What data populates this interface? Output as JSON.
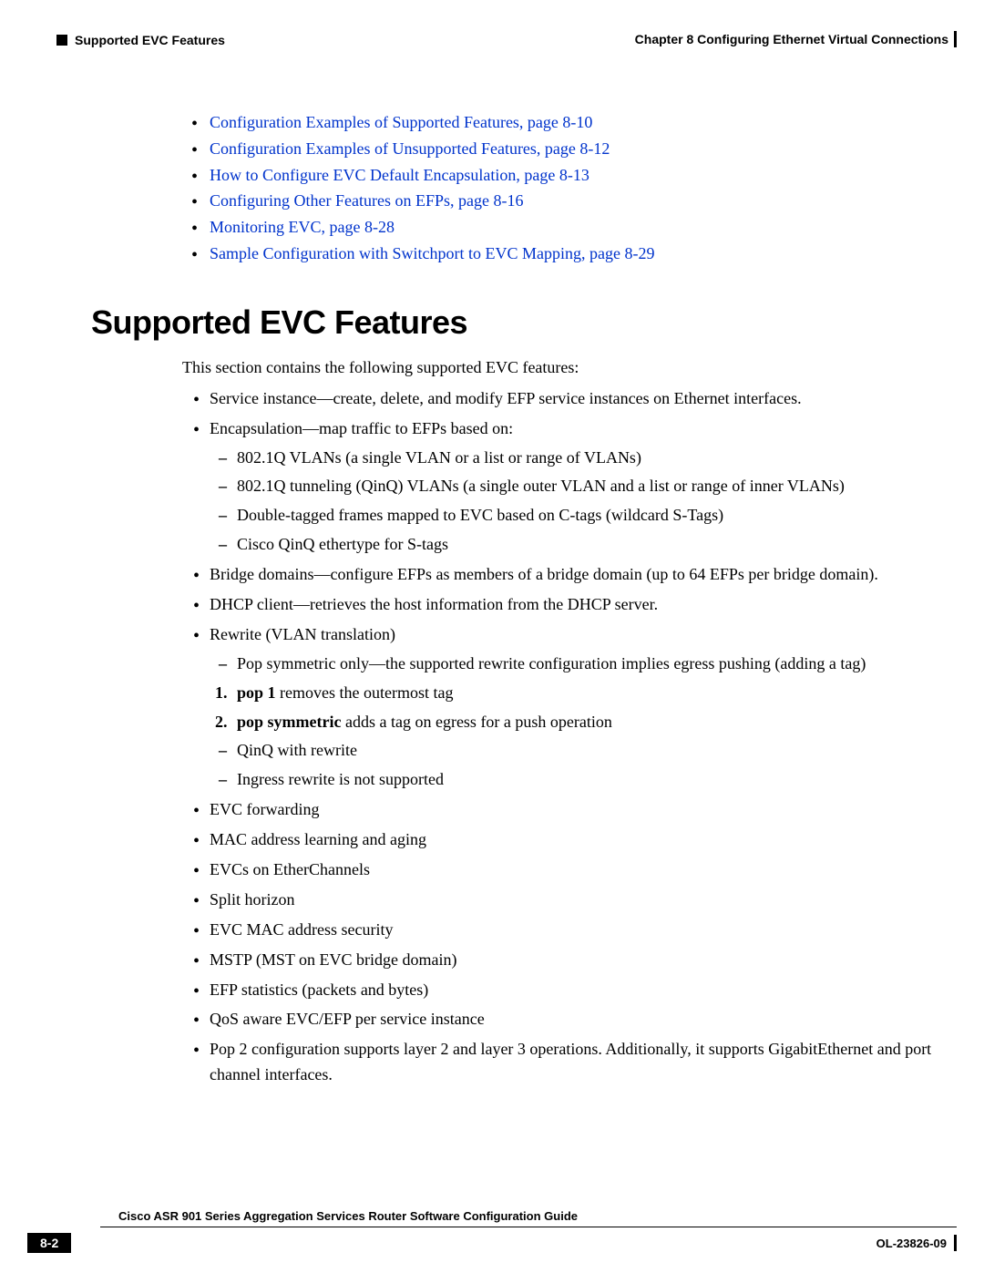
{
  "header": {
    "section": "Supported EVC Features",
    "chapter": "Chapter 8      Configuring Ethernet Virtual Connections"
  },
  "toc": [
    "Configuration Examples of Supported Features, page 8-10",
    "Configuration Examples of Unsupported Features, page 8-12",
    "How to Configure EVC Default Encapsulation, page 8-13",
    "Configuring Other Features on EFPs, page 8-16",
    "Monitoring EVC, page 8-28",
    "Sample Configuration with Switchport to EVC Mapping, page 8-29"
  ],
  "title": "Supported EVC Features",
  "intro": "This section contains the following supported EVC features:",
  "f": {
    "service_instance": "Service instance—create, delete, and modify EFP service instances on Ethernet interfaces.",
    "encapsulation": "Encapsulation—map traffic to EFPs based on:",
    "enc_sub1": "802.1Q VLANs (a single VLAN or a list or range of VLANs)",
    "enc_sub2": "802.1Q tunneling (QinQ) VLANs (a single outer VLAN and a list or range of inner VLANs)",
    "enc_sub3": "Double-tagged frames mapped to EVC based on C-tags (wildcard S-Tags)",
    "enc_sub4": "Cisco QinQ ethertype for S-tags",
    "bridge": "Bridge domains—configure EFPs as members of a bridge domain (up to 64 EFPs per bridge domain).",
    "dhcp": "DHCP client—retrieves the host information from the DHCP server.",
    "rewrite": "Rewrite (VLAN translation)",
    "rw_sub1": "Pop symmetric only—the supported rewrite configuration implies egress pushing (adding a tag)",
    "rw_num1_b": "pop 1",
    "rw_num1_r": " removes the outermost tag",
    "rw_num2_b": "pop symmetric",
    "rw_num2_r": " adds a tag on egress for a push operation",
    "rw_sub2": "QinQ with rewrite",
    "rw_sub3": "Ingress rewrite is not supported",
    "evc_fwd": "EVC forwarding",
    "mac": "MAC address learning and aging",
    "ether": "EVCs on EtherChannels",
    "split": "Split horizon",
    "macsec": "EVC MAC address security",
    "mstp": "MSTP (MST on EVC bridge domain)",
    "efp": "EFP statistics (packets and bytes)",
    "qos": "QoS aware EVC/EFP per service instance",
    "pop2": "Pop 2 configuration supports layer 2 and layer 3 operations. Additionally, it supports GigabitEthernet and port channel interfaces."
  },
  "footer": {
    "guide": "Cisco ASR 901 Series Aggregation Services Router Software Configuration Guide",
    "page": "8-2",
    "doc": "OL-23826-09"
  }
}
